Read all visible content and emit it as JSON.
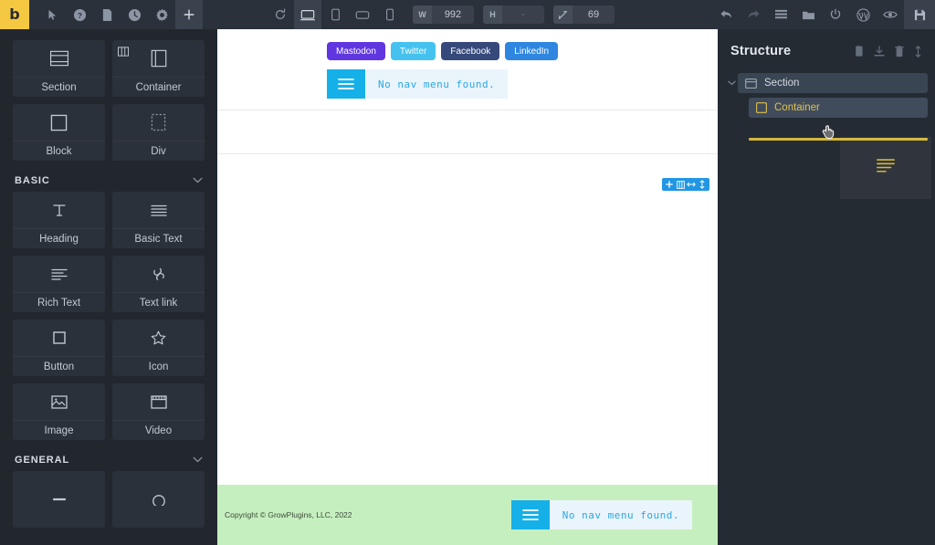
{
  "app": {
    "brand_letter": "b",
    "accent_yellow": "#f5c842",
    "panel_bg": "#22272e",
    "topbar_bg": "#2b313a"
  },
  "topbar": {
    "left_tools": [
      {
        "name": "pointer-icon",
        "label": "Select"
      },
      {
        "name": "help-icon",
        "label": "Help"
      },
      {
        "name": "page-icon",
        "label": "Pages"
      },
      {
        "name": "history-icon",
        "label": "History"
      },
      {
        "name": "gear-icon",
        "label": "Settings"
      },
      {
        "name": "plus-icon",
        "label": "Add"
      }
    ],
    "reload_label": "Reload",
    "viewports": [
      {
        "name": "desktop-icon",
        "label": "Desktop",
        "active": true
      },
      {
        "name": "tablet-portrait-icon",
        "label": "Tablet Portrait",
        "active": false
      },
      {
        "name": "tablet-landscape-icon",
        "label": "Tablet Landscape",
        "active": false
      },
      {
        "name": "mobile-icon",
        "label": "Mobile",
        "active": false
      }
    ],
    "width_label": "W",
    "width_value": "992",
    "height_label": "H",
    "height_value": "-",
    "zoom_label": "zoom",
    "zoom_value": "69",
    "right_tools": [
      {
        "name": "undo-icon",
        "label": "Undo"
      },
      {
        "name": "redo-icon",
        "label": "Redo"
      },
      {
        "name": "list-icon",
        "label": "Structure"
      },
      {
        "name": "folder-icon",
        "label": "Templates"
      },
      {
        "name": "power-icon",
        "label": "Exit"
      },
      {
        "name": "wordpress-icon",
        "label": "WordPress"
      },
      {
        "name": "eye-icon",
        "label": "Preview"
      }
    ],
    "save_label": "Save"
  },
  "left_panel": {
    "layout_elements": [
      {
        "label": "Section",
        "icon": "section-icon"
      },
      {
        "label": "Container",
        "icon": "container-icon",
        "badge": "columns-icon"
      },
      {
        "label": "Block",
        "icon": "block-icon"
      },
      {
        "label": "Div",
        "icon": "div-icon"
      }
    ],
    "groups": [
      {
        "title": "BASIC",
        "collapsed": false,
        "items": [
          {
            "label": "Heading",
            "icon": "heading-icon"
          },
          {
            "label": "Basic Text",
            "icon": "basic-text-icon"
          },
          {
            "label": "Rich Text",
            "icon": "rich-text-icon"
          },
          {
            "label": "Text link",
            "icon": "link-icon"
          },
          {
            "label": "Button",
            "icon": "button-icon"
          },
          {
            "label": "Icon",
            "icon": "star-icon"
          },
          {
            "label": "Image",
            "icon": "image-icon"
          },
          {
            "label": "Video",
            "icon": "video-icon"
          }
        ]
      },
      {
        "title": "GENERAL",
        "collapsed": false,
        "items": []
      }
    ]
  },
  "canvas": {
    "social_buttons": [
      {
        "label": "Mastodon",
        "color": "#6036e0"
      },
      {
        "label": "Twitter",
        "color": "#45c2ef"
      },
      {
        "label": "Facebook",
        "color": "#36497b"
      },
      {
        "label": "LinkedIn",
        "color": "#2f86e0"
      }
    ],
    "nav_widget": {
      "message": "No nav menu found.",
      "burger_color": "#15b0e8",
      "text_bg": "#eaf4fb",
      "text_color": "#2aa8e8"
    },
    "element_toolbar": {
      "bg": "#2196e3",
      "buttons": [
        {
          "name": "add-element-icon",
          "label": "Add"
        },
        {
          "name": "columns-icon",
          "label": "Columns"
        },
        {
          "name": "horizontal-resize-icon",
          "label": "Width"
        },
        {
          "name": "vertical-resize-icon",
          "label": "Height"
        }
      ]
    },
    "footer": {
      "bg": "#c6efbf",
      "copyright": "Copyright © GrowPlugins, LLC, 2022",
      "nav_message": "No nav menu found."
    }
  },
  "structure": {
    "title": "Structure",
    "actions": [
      {
        "name": "copy-icon",
        "label": "Copy"
      },
      {
        "name": "import-icon",
        "label": "Import"
      },
      {
        "name": "trash-icon",
        "label": "Delete"
      },
      {
        "name": "collapse-icon",
        "label": "Collapse all"
      }
    ],
    "nodes": [
      {
        "label": "Section",
        "icon": "section-icon",
        "depth": 0,
        "dragging": false,
        "expanded": true
      },
      {
        "label": "Container",
        "icon": "container-icon",
        "depth": 1,
        "dragging": true,
        "expanded": false
      }
    ],
    "drop_indicator_color": "#d4b838",
    "drag_ghost_icon": "lines-icon"
  }
}
